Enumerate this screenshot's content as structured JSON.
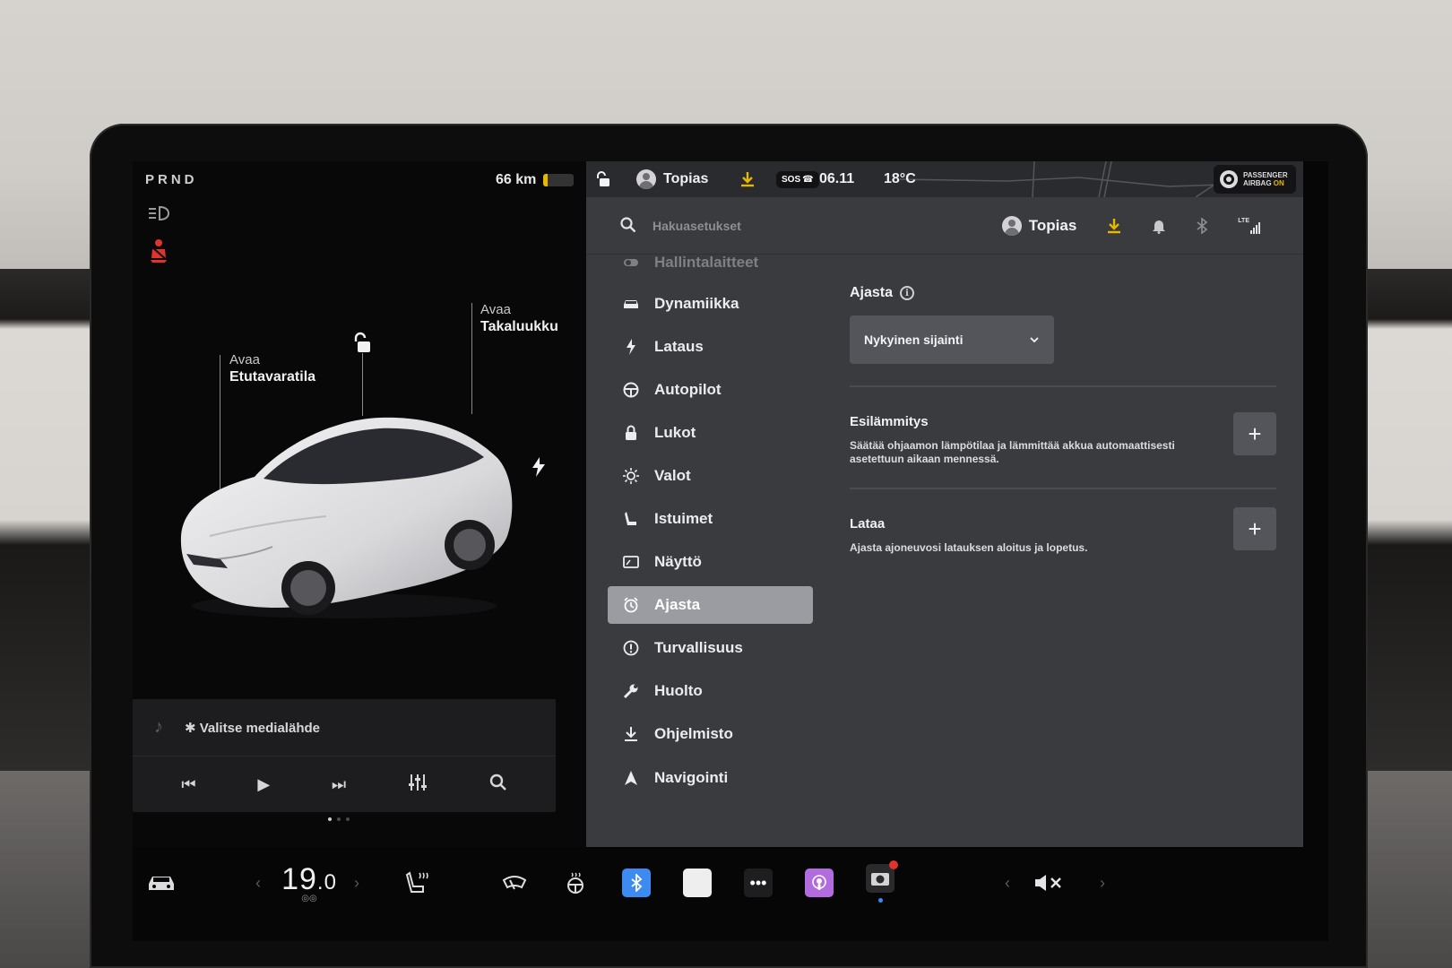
{
  "gear": "PRND",
  "range": {
    "text": "66 km",
    "battery_level": 0.15,
    "battery_color": "#e6b800"
  },
  "callouts": {
    "front": {
      "action": "Avaa",
      "target": "Etutavaratila"
    },
    "rear": {
      "action": "Avaa",
      "target": "Takaluukku"
    }
  },
  "media": {
    "source_label": "Valitse medialähde"
  },
  "topbar": {
    "profile": "Topias",
    "sos": "SOS",
    "time": "06.11",
    "temperature": "18°C",
    "airbag_line1": "PASSENGER",
    "airbag_line2": "AIRBAG",
    "airbag_state": "ON"
  },
  "search": {
    "placeholder": "Hakuasetukset",
    "profile": "Topias",
    "network": "LTE"
  },
  "nav": {
    "items": [
      {
        "label": "Hallintalaitteet",
        "icon": "toggle-icon"
      },
      {
        "label": "Dynamiikka",
        "icon": "car-icon"
      },
      {
        "label": "Lataus",
        "icon": "bolt-icon"
      },
      {
        "label": "Autopilot",
        "icon": "steering-wheel-icon"
      },
      {
        "label": "Lukot",
        "icon": "lock-icon"
      },
      {
        "label": "Valot",
        "icon": "sun-icon"
      },
      {
        "label": "Istuimet",
        "icon": "seat-icon"
      },
      {
        "label": "Näyttö",
        "icon": "display-icon"
      },
      {
        "label": "Ajasta",
        "icon": "alarm-clock-icon"
      },
      {
        "label": "Turvallisuus",
        "icon": "alert-circle-icon"
      },
      {
        "label": "Huolto",
        "icon": "wrench-icon"
      },
      {
        "label": "Ohjelmisto",
        "icon": "download-icon"
      },
      {
        "label": "Navigointi",
        "icon": "navigation-arrow-icon"
      }
    ],
    "active": "Ajasta"
  },
  "schedule": {
    "title": "Ajasta",
    "location_dropdown": "Nykyinen sijainti",
    "precondition": {
      "title": "Esilämmitys",
      "description": "Säätää ohjaamon lämpötilaa ja lämmittää akkua automaattisesti asetettuun aikaan mennessä."
    },
    "charge": {
      "title": "Lataa",
      "description": "Ajasta ajoneuvosi latauksen aloitus ja lopetus."
    }
  },
  "bottom": {
    "temp_whole": "19",
    "temp_decimal": ".0"
  },
  "colors": {
    "accent_yellow": "#e6b800",
    "active_nav": "#9b9ca1",
    "warning_red": "#e0332e"
  }
}
